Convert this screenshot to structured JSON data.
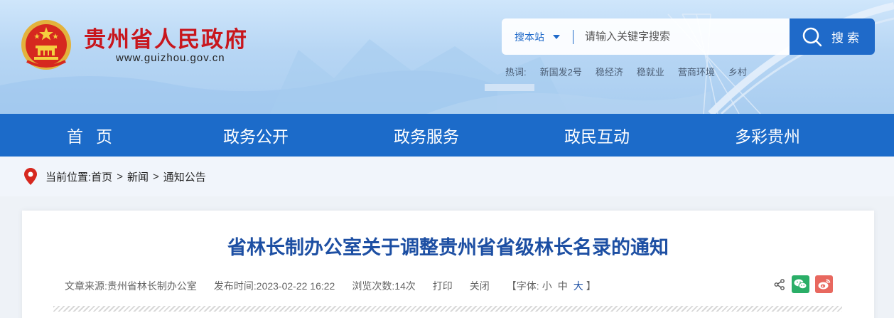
{
  "header": {
    "site_title": "贵州省人民政府",
    "site_url": "www.guizhou.gov.cn",
    "search": {
      "scope_label": "搜本站",
      "placeholder": "请输入关键字搜索",
      "button_label": "搜索"
    },
    "hot_words": {
      "label": "热词:",
      "items": [
        "新国发2号",
        "稳经济",
        "稳就业",
        "营商环境",
        "乡村"
      ]
    }
  },
  "nav": {
    "items": [
      "首页",
      "政务公开",
      "政务服务",
      "政民互动",
      "多彩贵州"
    ]
  },
  "breadcrumb": {
    "label": "当前位置:",
    "items": [
      "首页",
      "新闻",
      "通知公告"
    ],
    "separator": ">"
  },
  "article": {
    "title": "省林长制办公室关于调整贵州省省级林长名录的通知",
    "source_label": "文章来源:",
    "source": "贵州省林长制办公室",
    "date_label": "发布时间:",
    "date": "2023-02-22 16:22",
    "views_label": "浏览次数:",
    "views": "14次",
    "print_label": "打印",
    "close_label": "关闭",
    "font_size": {
      "open": "【字体:",
      "small": "小",
      "medium": "中",
      "large": "大",
      "close": "】"
    }
  },
  "colors": {
    "brand_red": "#c8161d",
    "nav_blue": "#1c6bc9",
    "title_blue": "#1d4fa3",
    "wechat_green": "#2aae67",
    "weibo_red": "#e8685f"
  },
  "icons": [
    "national-emblem-icon",
    "search-icon",
    "location-pin-icon",
    "share-icon",
    "wechat-icon",
    "weibo-icon"
  ]
}
